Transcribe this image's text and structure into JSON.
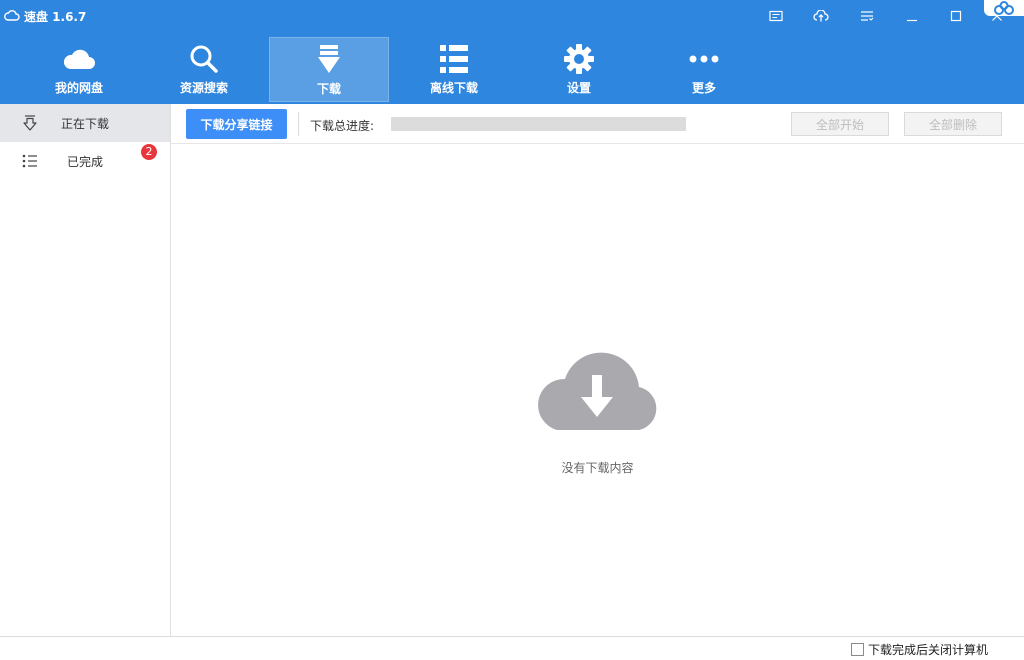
{
  "app": {
    "title": "速盘 1.6.7"
  },
  "nav": {
    "items": [
      {
        "label": "我的网盘",
        "icon": "cloud-icon"
      },
      {
        "label": "资源搜索",
        "icon": "search-icon"
      },
      {
        "label": "下载",
        "icon": "download-arrow-icon",
        "active": true
      },
      {
        "label": "离线下载",
        "icon": "list-icon"
      },
      {
        "label": "设置",
        "icon": "gear-icon"
      },
      {
        "label": "更多",
        "icon": "more-dots-icon"
      }
    ]
  },
  "sidebar": {
    "items": [
      {
        "label": "正在下载",
        "icon": "download-outline-icon",
        "active": true
      },
      {
        "label": "已完成",
        "icon": "list-bullets-icon",
        "badge": "2"
      }
    ]
  },
  "toolbar": {
    "share_link_button": "下载分享链接",
    "progress_label": "下载总进度:",
    "progress_value": 0,
    "start_all_button": "全部开始",
    "delete_all_button": "全部删除"
  },
  "empty_state": {
    "text": "没有下载内容",
    "icon": "cloud-download-icon"
  },
  "statusbar": {
    "shutdown_label": "下载完成后关闭计算机",
    "shutdown_checked": false
  },
  "colors": {
    "primary": "#2e86de",
    "button": "#3e8ef7",
    "badge": "#e8363d",
    "empty_icon": "#a9a9ae"
  }
}
